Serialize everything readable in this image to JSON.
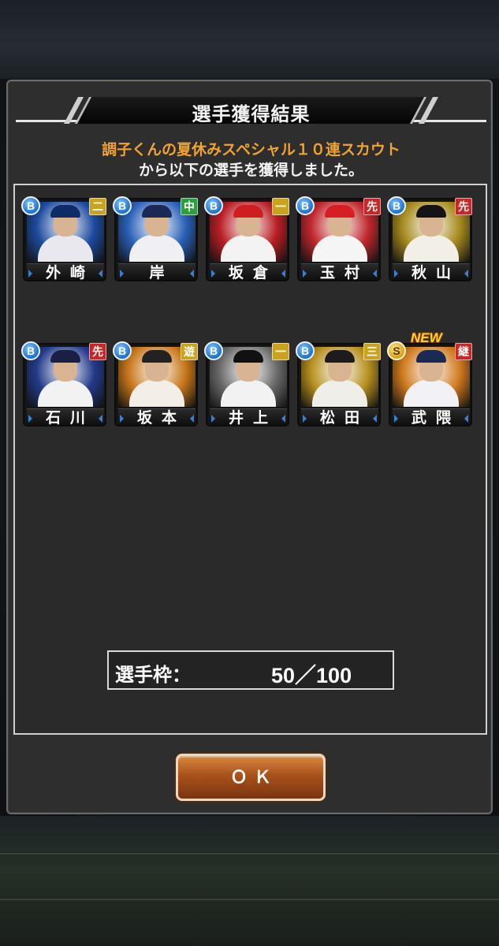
{
  "dialog": {
    "title": "選手獲得結果",
    "subtitle_line1": "調子くんの夏休みスペシャル１０連スカウト",
    "subtitle_line2": "から以下の選手を獲得しました。"
  },
  "players": [
    {
      "name": "外崎",
      "rank": "B",
      "position": "二",
      "position_color": "#c9a21e",
      "new": false,
      "bg": "#1d4a9e",
      "cap": "#0f2c66",
      "uniform": "#e8e8ee"
    },
    {
      "name": "岸",
      "rank": "B",
      "position": "中",
      "position_color": "#2e9e3e",
      "new": false,
      "bg": "#2a60b8",
      "cap": "#1a2a55",
      "uniform": "#f0f0f4"
    },
    {
      "name": "坂倉",
      "rank": "B",
      "position": "一",
      "position_color": "#c9a21e",
      "new": false,
      "bg": "#b81e24",
      "cap": "#d01e20",
      "uniform": "#f3f3f3"
    },
    {
      "name": "玉村",
      "rank": "B",
      "position": "先",
      "position_color": "#c62828",
      "new": false,
      "bg": "#c0272d",
      "cap": "#d61e24",
      "uniform": "#f5f5f5"
    },
    {
      "name": "秋山",
      "rank": "B",
      "position": "先",
      "position_color": "#c62828",
      "new": false,
      "bg": "#a78a1e",
      "cap": "#141414",
      "uniform": "#f2efe6"
    },
    {
      "name": "石川",
      "rank": "B",
      "position": "先",
      "position_color": "#c62828",
      "new": false,
      "bg": "#233a8a",
      "cap": "#1c1f45",
      "uniform": "#f2f2f2"
    },
    {
      "name": "坂本",
      "rank": "B",
      "position": "遊",
      "position_color": "#c9a21e",
      "new": false,
      "bg": "#c8761a",
      "cap": "#222222",
      "uniform": "#f3efe8"
    },
    {
      "name": "井上",
      "rank": "B",
      "position": "一",
      "position_color": "#c9a21e",
      "new": false,
      "bg": "#6a6a6a",
      "cap": "#111111",
      "uniform": "#f2f2f2"
    },
    {
      "name": "松田",
      "rank": "B",
      "position": "三",
      "position_color": "#c9a21e",
      "new": false,
      "bg": "#b7901f",
      "cap": "#1c1c1c",
      "uniform": "#f0eee8"
    },
    {
      "name": "武隈",
      "rank": "S",
      "position": "継",
      "position_color": "#c62828",
      "new": true,
      "new_label": "NEW",
      "bg": "#d07a1e",
      "cap": "#1a2a55",
      "uniform": "#f2f2f6"
    }
  ],
  "slots": {
    "label": "選手枠：",
    "value": "50／100"
  },
  "ok_button": "ＯＫ"
}
